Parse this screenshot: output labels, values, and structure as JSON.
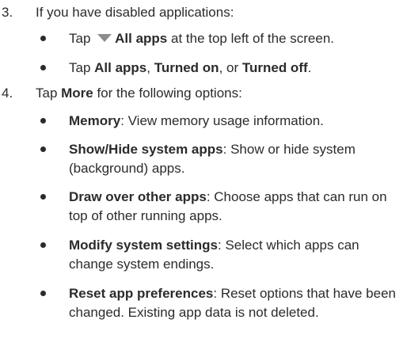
{
  "steps": [
    {
      "number": "3.",
      "text": "If you have disabled applications:",
      "bullets": [
        {
          "parts": [
            {
              "t": "Tap "
            },
            {
              "icon": "dropdown-triangle-icon"
            },
            {
              "t": "All apps",
              "b": true
            },
            {
              "t": " at the top left of the screen."
            }
          ]
        },
        {
          "parts": [
            {
              "t": "Tap "
            },
            {
              "t": "All apps",
              "b": true
            },
            {
              "t": ", "
            },
            {
              "t": "Turned on",
              "b": true
            },
            {
              "t": ", or "
            },
            {
              "t": "Turned off",
              "b": true
            },
            {
              "t": "."
            }
          ]
        }
      ]
    },
    {
      "number": "4.",
      "parts": [
        {
          "t": "Tap "
        },
        {
          "t": "More",
          "b": true
        },
        {
          "t": " for the following options:"
        }
      ],
      "bullets": [
        {
          "parts": [
            {
              "t": "Memory",
              "b": true
            },
            {
              "t": ": View memory usage information."
            }
          ]
        },
        {
          "parts": [
            {
              "t": "Show/Hide system apps",
              "b": true
            },
            {
              "t": ": Show or hide system (background) apps."
            }
          ]
        },
        {
          "parts": [
            {
              "t": "Draw over other apps",
              "b": true
            },
            {
              "t": ": Choose apps that can run on top of other running apps."
            }
          ]
        },
        {
          "parts": [
            {
              "t": "Modify system settings",
              "b": true
            },
            {
              "t": ": Select which apps can change system endings."
            }
          ]
        },
        {
          "parts": [
            {
              "t": "Reset app preferences",
              "b": true
            },
            {
              "t": ": Reset options that have been changed. Existing app data is not deleted."
            }
          ]
        }
      ]
    }
  ]
}
